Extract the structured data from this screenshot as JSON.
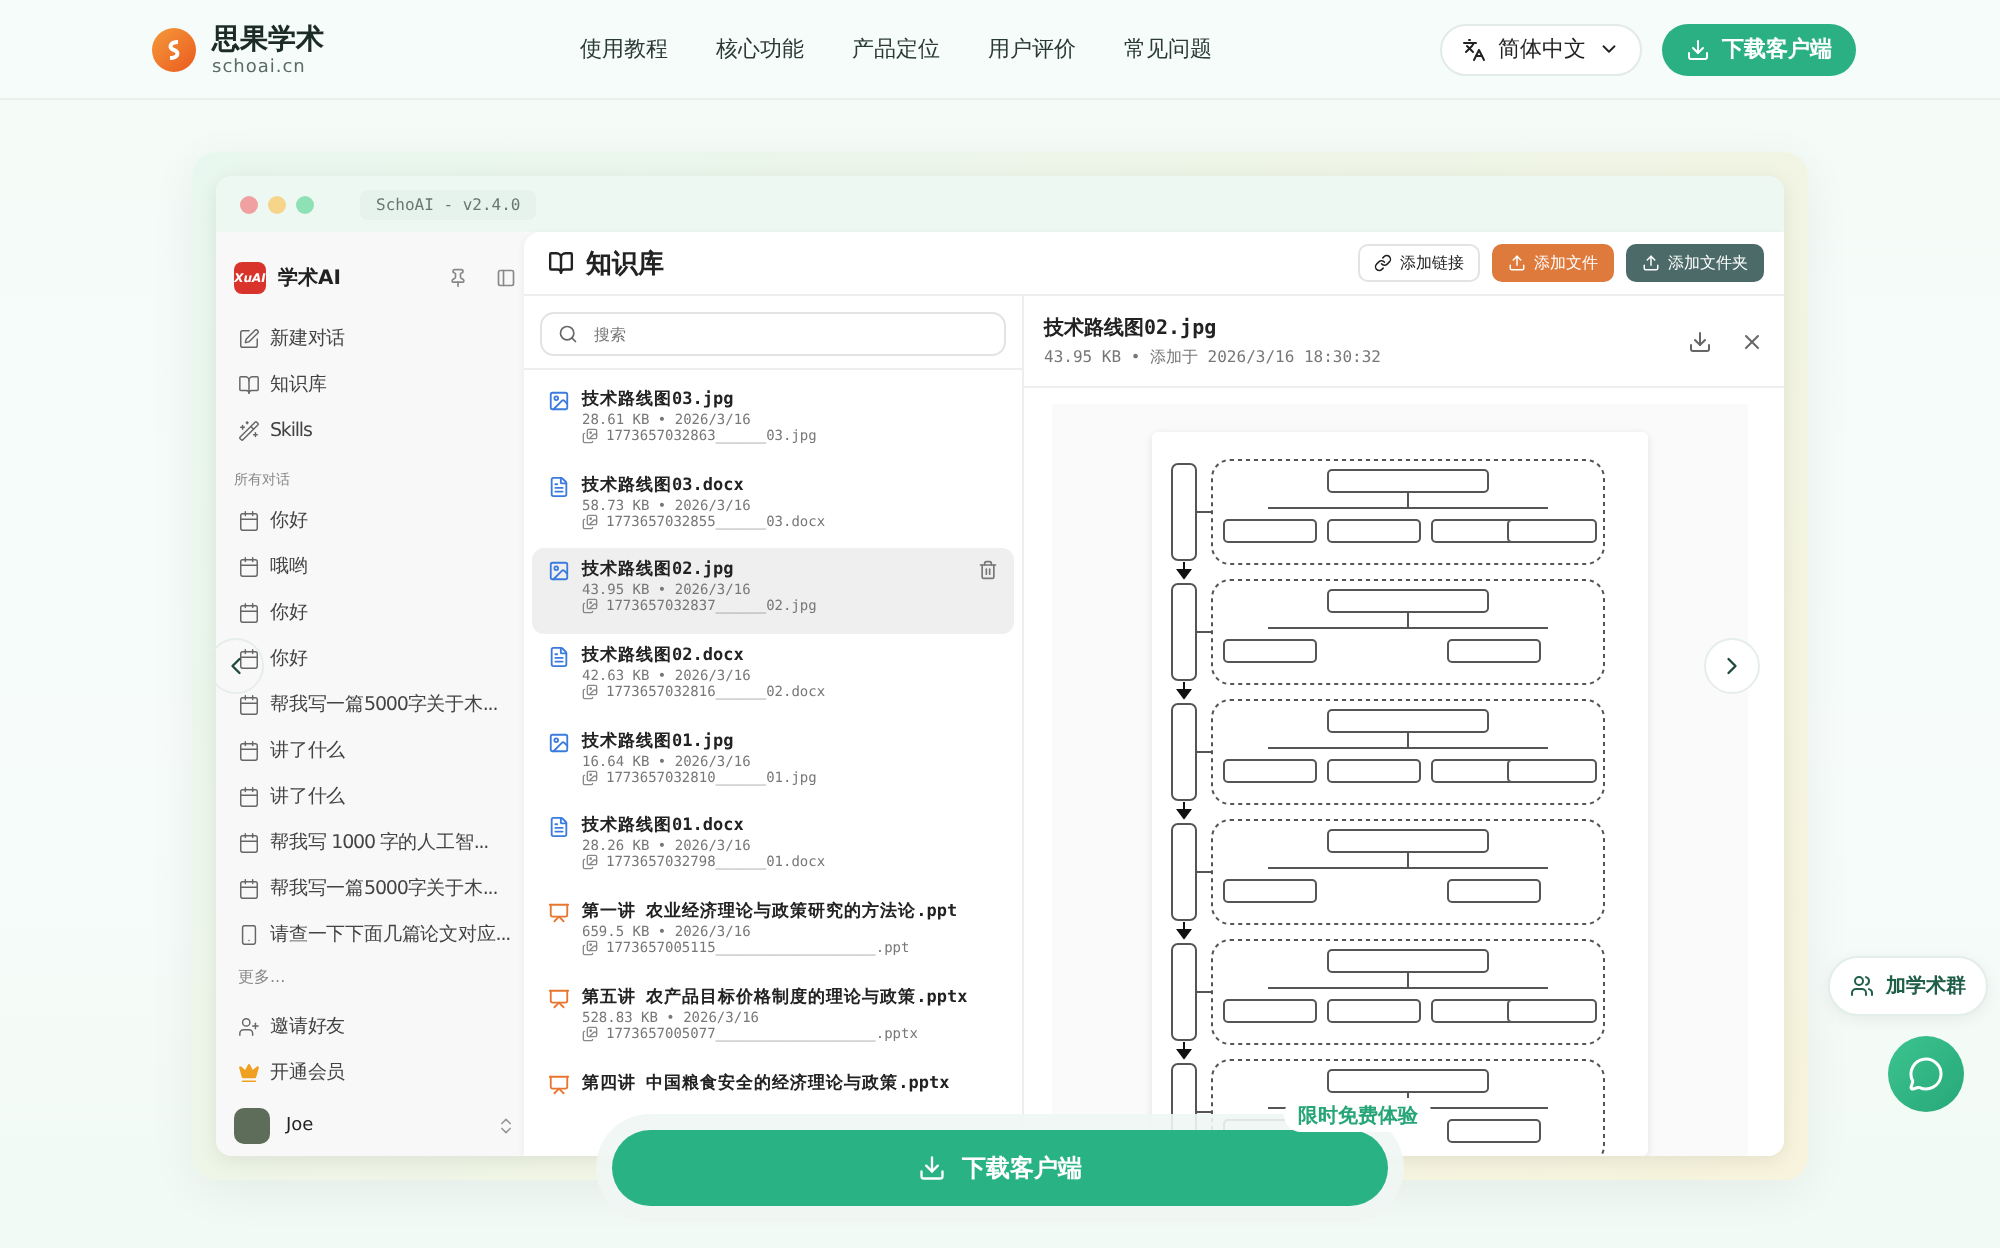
{
  "header": {
    "brand": "思果学术",
    "domain": "schoai.cn",
    "nav": [
      "使用教程",
      "核心功能",
      "产品定位",
      "用户评价",
      "常见问题"
    ],
    "language": "简体中文",
    "download": "下载客户端"
  },
  "window": {
    "title": "SchoAI - v2.4.0"
  },
  "sidebar": {
    "logo_text": "XuAI",
    "app_name": "学术AI",
    "menu": [
      {
        "label": "新建对话",
        "kind": "edit"
      },
      {
        "label": "知识库",
        "kind": "book"
      },
      {
        "label": "Skills",
        "kind": "wand"
      }
    ],
    "section": "所有对话",
    "conversations": [
      {
        "title": "你好",
        "kind": "chat"
      },
      {
        "title": "哦哟",
        "kind": "chat"
      },
      {
        "title": "你好",
        "kind": "chat"
      },
      {
        "title": "你好",
        "kind": "chat"
      },
      {
        "title": "帮我写一篇5000字关于木...",
        "kind": "chat"
      },
      {
        "title": "讲了什么",
        "kind": "chat"
      },
      {
        "title": "讲了什么",
        "kind": "chat"
      },
      {
        "title": "帮我写 1000 字的人工智...",
        "kind": "chat"
      },
      {
        "title": "帮我写一篇5000字关于木...",
        "kind": "chat"
      },
      {
        "title": "请查一下下面几篇论文对应...",
        "kind": "doc"
      }
    ],
    "more": "更多...",
    "footer": [
      {
        "label": "邀请好友",
        "kind": "invite"
      },
      {
        "label": "开通会员",
        "kind": "crown"
      }
    ],
    "user": {
      "name": "Joe"
    }
  },
  "knowledge": {
    "title": "知识库",
    "actions": [
      {
        "label": "添加链接",
        "kind": "link"
      },
      {
        "label": "添加文件",
        "kind": "file"
      },
      {
        "label": "添加文件夹",
        "kind": "folder"
      }
    ],
    "search": {
      "placeholder": "搜索"
    },
    "files": [
      {
        "name": "技术路线图03.jpg",
        "kind": "image",
        "meta": "28.61 KB • 2026/3/16",
        "stored": "1773657032863______03.jpg",
        "selected": false
      },
      {
        "name": "技术路线图03.docx",
        "kind": "doc",
        "meta": "58.73 KB • 2026/3/16",
        "stored": "1773657032855______03.docx",
        "selected": false
      },
      {
        "name": "技术路线图02.jpg",
        "kind": "image",
        "meta": "43.95 KB • 2026/3/16",
        "stored": "1773657032837______02.jpg",
        "selected": true
      },
      {
        "name": "技术路线图02.docx",
        "kind": "doc",
        "meta": "42.63 KB • 2026/3/16",
        "stored": "1773657032816______02.docx",
        "selected": false
      },
      {
        "name": "技术路线图01.jpg",
        "kind": "image",
        "meta": "16.64 KB • 2026/3/16",
        "stored": "1773657032810______01.jpg",
        "selected": false
      },
      {
        "name": "技术路线图01.docx",
        "kind": "doc",
        "meta": "28.26 KB • 2026/3/16",
        "stored": "1773657032798______01.docx",
        "selected": false
      },
      {
        "name": "第一讲 农业经济理论与政策研究的方法论.ppt",
        "kind": "slides",
        "meta": "659.5 KB • 2026/3/16",
        "stored": "1773657005115___________________.ppt",
        "selected": false
      },
      {
        "name": "第五讲 农产品目标价格制度的理论与政策.pptx",
        "kind": "slides",
        "meta": "528.83 KB • 2026/3/16",
        "stored": "1773657005077___________________.pptx",
        "selected": false
      },
      {
        "name": "第四讲 中国粮食安全的经济理论与政策.pptx",
        "kind": "slides",
        "selected": false
      }
    ]
  },
  "preview": {
    "name": "技术路线图02.jpg",
    "meta": "43.95 KB • 添加于 2026/3/16 18:30:32"
  },
  "promo": {
    "badge": "限时免费体验",
    "download": "下载客户端"
  },
  "floating": {
    "group": "加学术群"
  }
}
